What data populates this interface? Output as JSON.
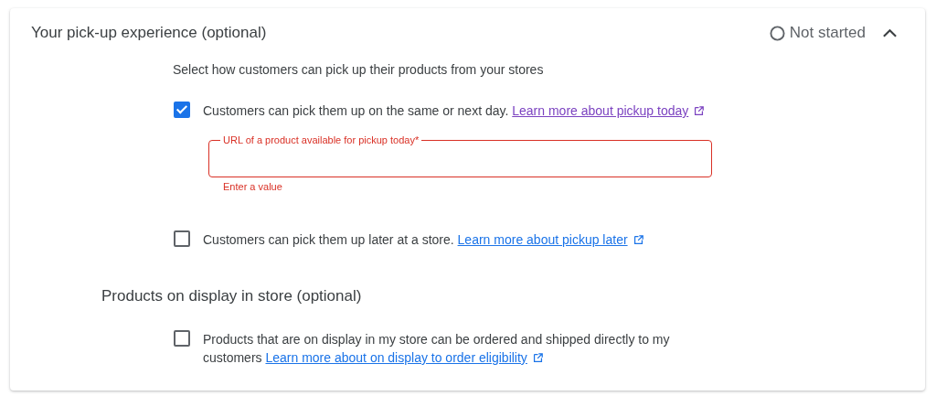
{
  "card": {
    "title": "Your pick-up experience (optional)",
    "status": "Not started",
    "expanded": true
  },
  "intro": "Select how customers can pick up their products from your stores",
  "options": [
    {
      "checked": true,
      "text": "Customers can pick them up on the same or next day.",
      "link": {
        "label": "Learn more about pickup today",
        "visited": true
      },
      "field": {
        "label": "URL of a product available for pickup today*",
        "invalid": true,
        "error": "Enter a value"
      }
    },
    {
      "checked": false,
      "text": "Customers can pick them up later at a store.",
      "link": {
        "label": "Learn more about pickup later",
        "visited": false
      }
    }
  ],
  "section2": {
    "heading": "Products on display in store (optional)",
    "options": [
      {
        "checked": false,
        "text": "Products that are on display in my store can be ordered and shipped directly to my customers",
        "link": {
          "label": "Learn more about on display to order eligibility",
          "visited": false
        }
      }
    ]
  }
}
